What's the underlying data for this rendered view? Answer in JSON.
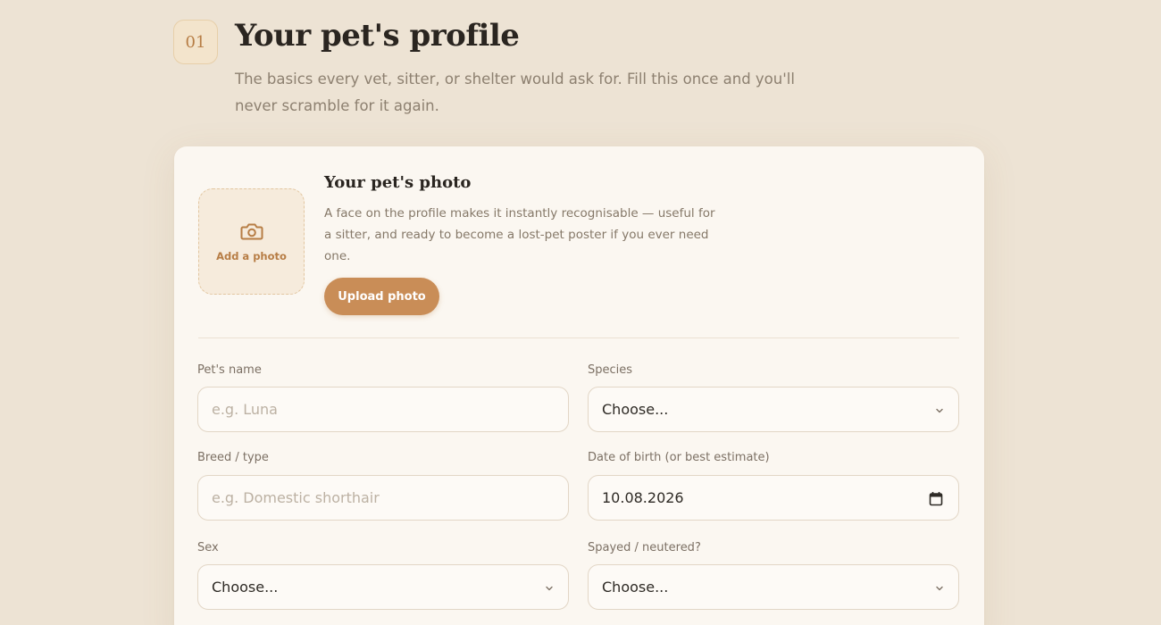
{
  "header": {
    "step_number": "01",
    "title": "Your pet's profile",
    "subtitle": "The basics every vet, sitter, or shelter would ask for. Fill this once and you'll never scramble for it again."
  },
  "photo_section": {
    "drop_label": "Add a photo",
    "title": "Your pet's photo",
    "description": "A face on the profile makes it instantly recognisable — useful for a sitter, and ready to become a lost-pet poster if you ever need one.",
    "upload_label": "Upload photo",
    "icon": "camera-icon"
  },
  "form": {
    "pet_name": {
      "label": "Pet's name",
      "placeholder": "e.g. Luna",
      "value": ""
    },
    "species": {
      "label": "Species",
      "value": "Choose..."
    },
    "breed": {
      "label": "Breed / type",
      "placeholder": "e.g. Domestic shorthair",
      "value": ""
    },
    "dob": {
      "label": "Date of birth (or best estimate)",
      "value": "10.08.2026"
    },
    "sex": {
      "label": "Sex",
      "value": "Choose..."
    },
    "spayed": {
      "label": "Spayed / neutered?",
      "value": "Choose..."
    }
  },
  "colors": {
    "background": "#ede3d4",
    "card": "#fbf7f1",
    "accent": "#c98d57",
    "accent_text": "#b77d45"
  }
}
